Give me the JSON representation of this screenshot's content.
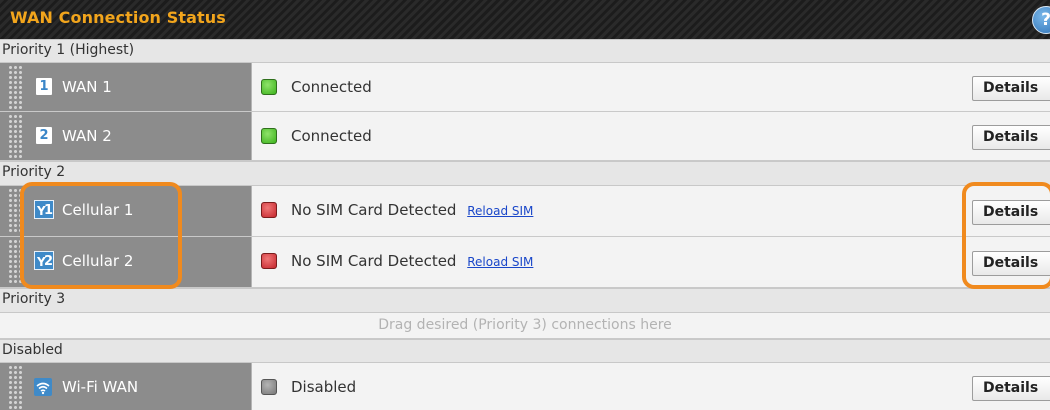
{
  "header": {
    "title": "WAN Connection Status",
    "help_label": "?"
  },
  "priority_groups": [
    {
      "label": "Priority 1 (Highest)"
    },
    {
      "label": "Priority 2"
    },
    {
      "label": "Priority 3",
      "dropzone_text": "Drag desired (Priority 3) connections here"
    },
    {
      "label": "Disabled"
    }
  ],
  "connections": [
    {
      "badge": "1",
      "name": "WAN 1",
      "status": "Connected",
      "status_color": "#3cb21c",
      "details_label": "Details"
    },
    {
      "badge": "2",
      "name": "WAN 2",
      "status": "Connected",
      "status_color": "#3cb21c",
      "details_label": "Details"
    },
    {
      "badge": "1",
      "name": "Cellular 1",
      "status": "No SIM Card Detected",
      "reload_label": "Reload SIM",
      "status_color": "#c5262d",
      "details_label": "Details"
    },
    {
      "badge": "2",
      "name": "Cellular 2",
      "status": "No SIM Card Detected",
      "reload_label": "Reload SIM",
      "status_color": "#c5262d",
      "details_label": "Details"
    },
    {
      "badge_icon": "wifi-icon",
      "name": "Wi-Fi WAN",
      "status": "Disabled",
      "status_color": "#777777",
      "details_label": "Details"
    }
  ],
  "colors": {
    "accent_orange": "#f08a1e",
    "header_text": "#f2a51c",
    "link": "#1a47c9"
  }
}
